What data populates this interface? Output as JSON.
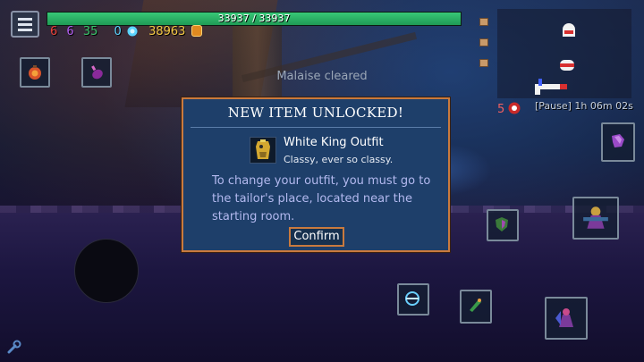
{
  "hud": {
    "health": {
      "current": 33937,
      "max": 33937,
      "text": "33937 / 33937"
    },
    "scrolls": {
      "brutality": "6",
      "tactics": "6",
      "survival": "35"
    },
    "cells": "0",
    "gold": "38963",
    "curse_count": "5",
    "timer": "[Pause] 1h 06m 02s"
  },
  "status_message": "Malaise cleared",
  "dialog": {
    "title": "NEW ITEM UNLOCKED!",
    "item_name": "White King Outfit",
    "item_description": "Classy, ever so classy.",
    "body": "To change your outfit, you must go to the tailor's place, located near the starting room.",
    "confirm_label": "Confirm"
  },
  "colors": {
    "health_fill": "#38c877",
    "dialog_bg": "#1e3f6a",
    "dialog_border": "#c97a3e",
    "brutality": "#e8413a",
    "tactics": "#b15cf0",
    "survival": "#39c46a",
    "cells": "#5ad4ff",
    "gold": "#f2c744"
  },
  "icons": {
    "menu": "hamburger-menu-icon",
    "cell": "cell-gem-icon",
    "gold": "gold-coin-icon",
    "curse": "curse-skull-icon",
    "settings": "wrench-icon"
  }
}
